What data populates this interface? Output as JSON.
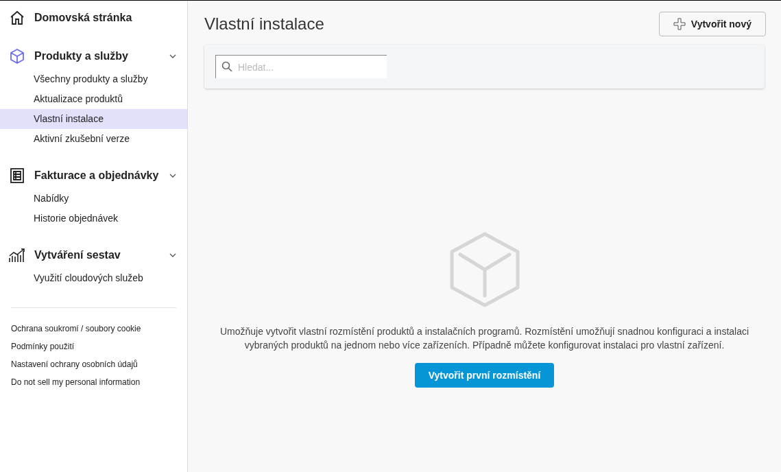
{
  "sidebar": {
    "sections": [
      {
        "kind": "link",
        "label": "Domovská stránka"
      },
      {
        "kind": "group",
        "label": "Produkty a služby",
        "expanded": true,
        "items": [
          {
            "label": "Všechny produkty a služby",
            "selected": false
          },
          {
            "label": "Aktualizace produktů",
            "selected": false
          },
          {
            "label": "Vlastní instalace",
            "selected": true
          },
          {
            "label": "Aktivní zkušební verze",
            "selected": false
          }
        ]
      },
      {
        "kind": "group",
        "label": "Fakturace a objednávky",
        "expanded": true,
        "items": [
          {
            "label": "Nabídky",
            "selected": false
          },
          {
            "label": "Historie objednávek",
            "selected": false
          }
        ]
      },
      {
        "kind": "group",
        "label": "Vytváření sestav",
        "expanded": true,
        "items": [
          {
            "label": "Využití cloudových služeb",
            "selected": false
          }
        ]
      }
    ],
    "footer_links": [
      "Ochrana soukromí / soubory cookie",
      "Podmínky použití",
      "Nastavení ochrany osobních údajů",
      "Do not sell my personal information"
    ]
  },
  "main": {
    "title": "Vlastní instalace",
    "create_button": "Vytvořit nový",
    "search": {
      "placeholder": "Hledat..."
    },
    "empty_state": {
      "description": "Umožňuje vytvořit vlastní rozmístění produktů a instalačních programů. Rozmístění umožňují snadnou konfiguraci a instalaci vybraných produktů na jednom nebo více zařízeních. Případně můžete konfigurovat instalaci pro vlastní zařízení.",
      "button": "Vytvořit první rozmístění"
    }
  }
}
